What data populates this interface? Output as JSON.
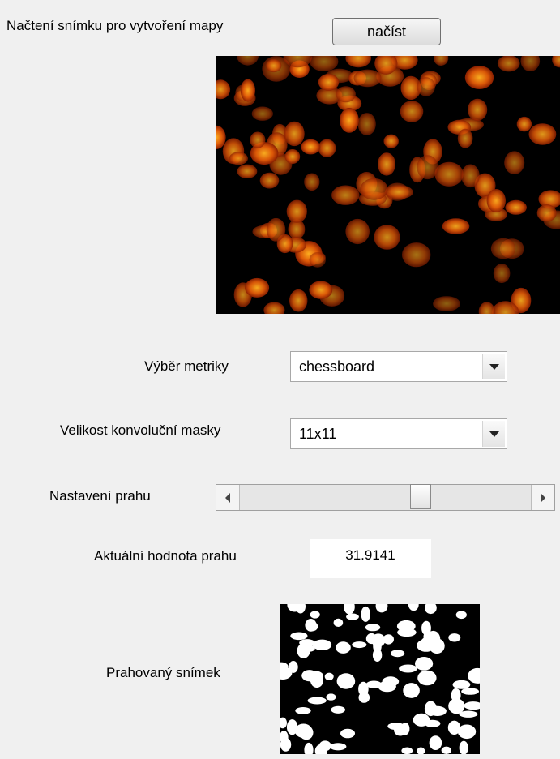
{
  "load": {
    "label": "Načtení snímku pro vytvoření mapy",
    "button": "načíst"
  },
  "metric": {
    "label": "Výběr metriky",
    "value": "chessboard"
  },
  "mask": {
    "label": "Velikost konvoluční masky",
    "value": "11x11"
  },
  "threshold": {
    "label": "Nastavení prahu",
    "slider_position": 0.63,
    "current_label": "Aktuální hodnota prahu",
    "current_value": "31.9141"
  },
  "result": {
    "label": "Prahovaný snímek"
  },
  "icons": {
    "dropdown": "chevron-down-icon",
    "slider_left": "arrow-left-icon",
    "slider_right": "arrow-right-icon"
  },
  "colors": {
    "cell_bright": "#ffb020",
    "cell_dark": "#8a1e00"
  }
}
